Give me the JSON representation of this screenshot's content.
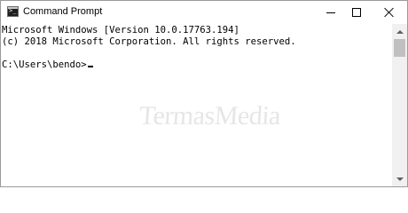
{
  "window": {
    "title": "Command Prompt",
    "icon": "cmd-icon"
  },
  "controls": {
    "minimize": "minimize-icon",
    "maximize": "maximize-icon",
    "close": "close-icon"
  },
  "console": {
    "lines": [
      "Microsoft Windows [Version 10.0.17763.194]",
      "(c) 2018 Microsoft Corporation. All rights reserved.",
      "C:\\Users\\bendo>"
    ],
    "cursor": "_"
  },
  "watermark": "TermasMedia",
  "colors": {
    "background": "#ffffff",
    "text": "#000000",
    "scrollbar": "#f0f0f0",
    "scroll_thumb": "#c0c0c0"
  }
}
